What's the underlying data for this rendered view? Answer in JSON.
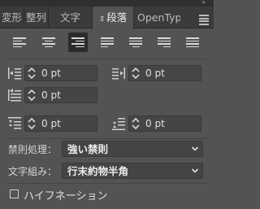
{
  "tabs": [
    {
      "label": "変形"
    },
    {
      "label": "整列"
    },
    {
      "label": "文字"
    },
    {
      "label": "段落",
      "active": true
    },
    {
      "label": "OpenType"
    }
  ],
  "alignment": {
    "options": [
      "left-align",
      "center-align",
      "right-align",
      "justify-last-left",
      "justify-last-center",
      "justify-last-right",
      "justify-all"
    ],
    "selected": "right-align"
  },
  "indents": {
    "left_indent": "0 pt",
    "right_indent": "0 pt",
    "first_line_indent": "0 pt"
  },
  "spacing": {
    "space_before": "0 pt",
    "space_after": "0 pt"
  },
  "kinsoku": {
    "label": "禁則処理：",
    "value": "強い禁則"
  },
  "mojikumi": {
    "label": "文字組み：",
    "value": "行末約物半角"
  },
  "hyphenation": {
    "label": "ハイフネーション",
    "checked": false
  },
  "colors": {
    "panel_bg": "#535353",
    "tab_bar_bg": "#3b3b3b",
    "field_bg": "#454545",
    "selected_btn_bg": "#2b2b2b"
  }
}
